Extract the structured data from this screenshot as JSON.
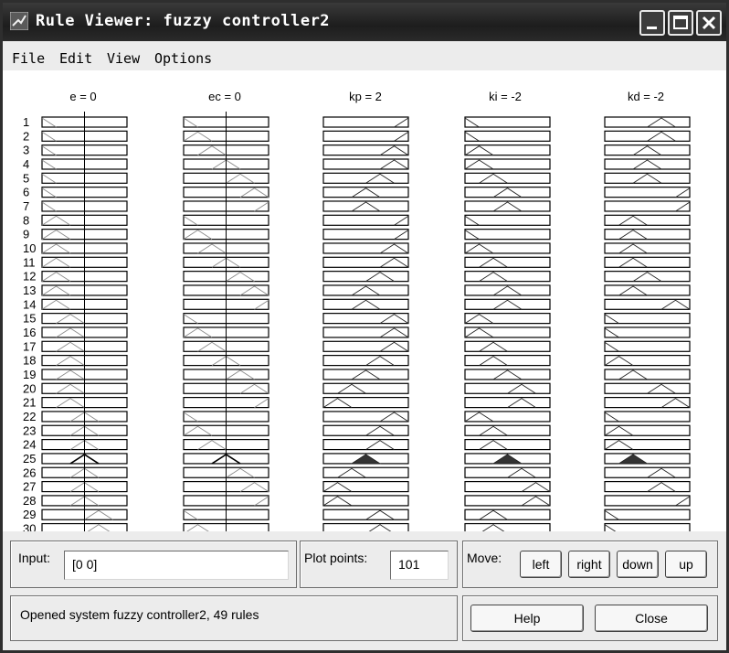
{
  "window": {
    "title": "Rule Viewer: fuzzy controller2"
  },
  "menu": [
    "File",
    "Edit",
    "View",
    "Options"
  ],
  "variables": [
    {
      "name": "e",
      "label": "e = 0",
      "kind": "input",
      "value": 0
    },
    {
      "name": "ec",
      "label": "ec = 0",
      "kind": "input",
      "value": 0
    },
    {
      "name": "kp",
      "label": "kp = 2",
      "kind": "output",
      "value": 2
    },
    {
      "name": "ki",
      "label": "ki = -2",
      "kind": "output",
      "value": -2
    },
    {
      "name": "kd",
      "label": "kd = -2",
      "kind": "output",
      "value": -2
    }
  ],
  "rules": {
    "visible_numbers": [
      "1",
      "2",
      "3",
      "4",
      "5",
      "6",
      "7",
      "8",
      "9",
      "10",
      "11",
      "12",
      "13",
      "14",
      "15",
      "16",
      "17",
      "18",
      "19",
      "20",
      "21",
      "22",
      "23",
      "24",
      "25",
      "26",
      "27",
      "28",
      "29",
      "30"
    ],
    "active_rule": "25",
    "membership": {
      "e": [
        "NB",
        "NB",
        "NB",
        "NB",
        "NB",
        "NB",
        "NB",
        "NM",
        "NM",
        "NM",
        "NM",
        "NM",
        "NM",
        "NM",
        "NS",
        "NS",
        "NS",
        "NS",
        "NS",
        "NS",
        "NS",
        "ZO",
        "ZO",
        "ZO",
        "ZO",
        "ZO",
        "ZO",
        "ZO",
        "PS",
        "PS"
      ],
      "ec": [
        "NB",
        "NM",
        "NS",
        "ZO",
        "PS",
        "PM",
        "PB",
        "NB",
        "NM",
        "NS",
        "ZO",
        "PS",
        "PM",
        "PB",
        "NB",
        "NM",
        "NS",
        "ZO",
        "PS",
        "PM",
        "PB",
        "NB",
        "NM",
        "NS",
        "ZO",
        "PS",
        "PM",
        "PB",
        "NB",
        "NM"
      ],
      "kp": [
        "PB",
        "PB",
        "PM",
        "PM",
        "PS",
        "ZO",
        "ZO",
        "PB",
        "PB",
        "PM",
        "PM",
        "PS",
        "ZO",
        "ZO",
        "PM",
        "PM",
        "PM",
        "PS",
        "ZO",
        "NS",
        "NM",
        "PM",
        "PS",
        "PS",
        "ZO",
        "NS",
        "NM",
        "NM",
        "PS",
        "PS"
      ],
      "ki": [
        "NB",
        "NB",
        "NM",
        "NM",
        "NS",
        "ZO",
        "ZO",
        "NB",
        "NB",
        "NM",
        "NS",
        "NS",
        "ZO",
        "ZO",
        "NM",
        "NM",
        "NS",
        "NS",
        "ZO",
        "PS",
        "PS",
        "NM",
        "NS",
        "NS",
        "ZO",
        "PS",
        "PM",
        "PM",
        "NS",
        "NS"
      ],
      "kd": [
        "PS",
        "PS",
        "ZO",
        "ZO",
        "ZO",
        "PB",
        "PB",
        "NS",
        "NS",
        "NS",
        "NS",
        "ZO",
        "NS",
        "PM",
        "NB",
        "NB",
        "NB",
        "NM",
        "NS",
        "PS",
        "PM",
        "NB",
        "NM",
        "NM",
        "NS",
        "PS",
        "PS",
        "PB",
        "NB",
        "NB"
      ]
    }
  },
  "input_panel": {
    "label": "Input:",
    "value": "[0 0]"
  },
  "plot_points": {
    "label": "Plot points:",
    "value": "101"
  },
  "move": {
    "label": "Move:",
    "buttons": [
      "left",
      "right",
      "down",
      "up"
    ]
  },
  "status": "Opened system fuzzy controller2, 49 rules",
  "actions": {
    "help": "Help",
    "close": "Close"
  }
}
